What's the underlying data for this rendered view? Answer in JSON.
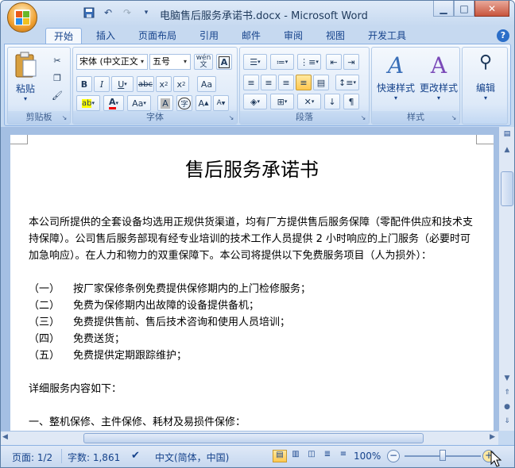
{
  "window": {
    "title": "电脑售后服务承诺书.docx - Microsoft Word"
  },
  "qat": {
    "save_icon": "save-icon",
    "undo_icon": "undo-icon",
    "redo_icon": "redo-icon"
  },
  "tabs": [
    "开始",
    "插入",
    "页面布局",
    "引用",
    "邮件",
    "审阅",
    "视图",
    "开发工具"
  ],
  "ribbon": {
    "clipboard": {
      "label": "剪贴板",
      "paste": "粘贴"
    },
    "font": {
      "label": "字体",
      "font_name": "宋体 (中文正文",
      "font_size": "五号",
      "wen": "wén\n文"
    },
    "paragraph": {
      "label": "段落"
    },
    "styles": {
      "label": "样式",
      "quick_styles": "快速样式",
      "change_styles": "更改样式"
    },
    "editing": {
      "label": "编辑",
      "edit": "编辑"
    }
  },
  "document": {
    "title": "售后服务承诺书",
    "intro": "本公司所提供的全套设备均选用正规供货渠道，均有厂方提供售后服务保障（零配件供应和技术支持保障）。公司售后服务部现有经专业培训的技术工作人员提供 2 小时响应的上门服务（必要时可加急响应）。在人力和物力的双重保障下。本公司将提供以下免费服务项目（人为损外）：",
    "items": [
      {
        "num": "（一）",
        "text": "按厂家保修条例免费提供保修期内的上门检修服务；"
      },
      {
        "num": "（二）",
        "text": "免费为保修期内出故障的设备提供备机；"
      },
      {
        "num": "（三）",
        "text": "免费提供售前、售后技术咨询和使用人员培训；"
      },
      {
        "num": "（四）",
        "text": "免费送货；"
      },
      {
        "num": "（五）",
        "text": "免费提供定期跟踪维护；"
      }
    ],
    "details_heading": "详细服务内容如下：",
    "section1": "一、整机保修、主件保修、耗材及易损件保修："
  },
  "status": {
    "page": "页面: 1/2",
    "words": "字数: 1,861",
    "language": "中文(简体，中国)",
    "zoom": "100%",
    "zoom_level": 1.0
  }
}
